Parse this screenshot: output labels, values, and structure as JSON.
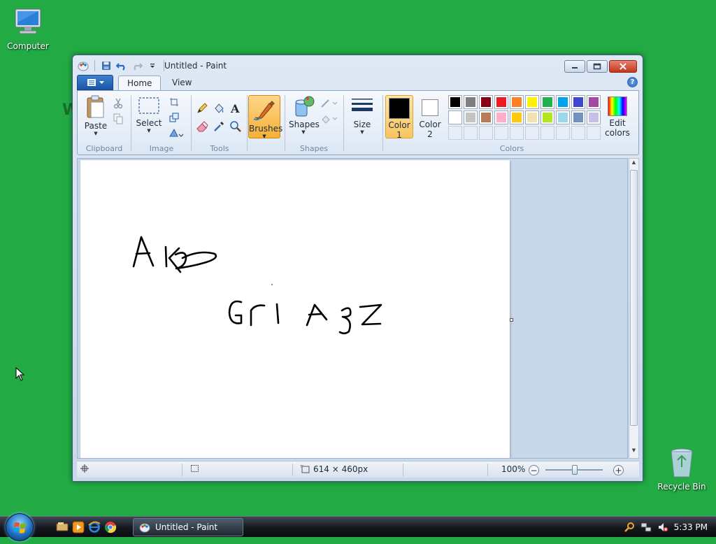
{
  "desktop": {
    "computer_label": "Computer",
    "recycle_label": "Recycle Bin",
    "ghost_letter": "W",
    "background_color": "#22ab45"
  },
  "window": {
    "title": "Untitled - Paint",
    "qat_icons": [
      "paint-app-icon",
      "save-icon",
      "undo-icon",
      "redo-icon",
      "customize-dropdown-icon"
    ]
  },
  "tabs": {
    "home": "Home",
    "view": "View"
  },
  "ribbon": {
    "clipboard": {
      "group_label": "Clipboard",
      "paste_label": "Paste"
    },
    "image": {
      "group_label": "Image",
      "select_label": "Select"
    },
    "tools": {
      "group_label": "Tools"
    },
    "brushes": {
      "label": "Brushes"
    },
    "shapes": {
      "group_label": "Shapes",
      "label": "Shapes"
    },
    "size": {
      "label": "Size"
    },
    "colors": {
      "group_label": "Colors",
      "color1_label": "Color",
      "color1_num": "1",
      "color2_label": "Color",
      "color2_num": "2",
      "edit_label_1": "Edit",
      "edit_label_2": "colors",
      "color1_value": "#000000",
      "color2_value": "#ffffff",
      "palette_row1": [
        "#000000",
        "#7f7f7f",
        "#880015",
        "#ed1c24",
        "#ff7f27",
        "#fff200",
        "#22b14c",
        "#00a2e8",
        "#3f48cc",
        "#a349a4"
      ],
      "palette_row2": [
        "#ffffff",
        "#c3c3c3",
        "#b97a57",
        "#ffaec9",
        "#ffc90e",
        "#efe4b0",
        "#b5e61d",
        "#99d9ea",
        "#7092be",
        "#c8bfe7"
      ],
      "palette_row3_empty": 10
    }
  },
  "canvas": {
    "drawing": [
      "AKB",
      "Gri AZZ"
    ]
  },
  "status": {
    "dimensions": "614 × 460px",
    "zoom": "100%"
  },
  "taskbar": {
    "task_label": "Untitled - Paint",
    "clock": "5:33 PM"
  }
}
